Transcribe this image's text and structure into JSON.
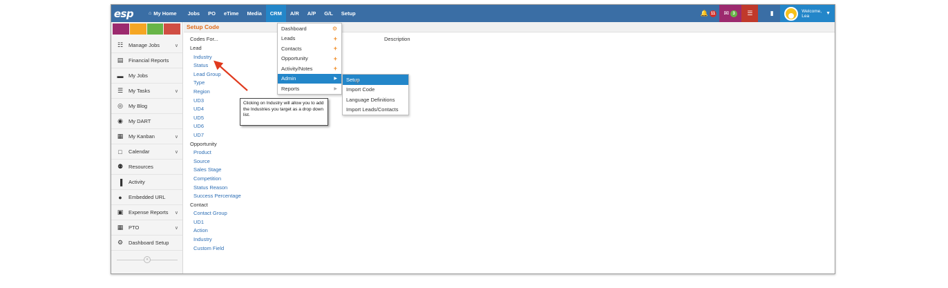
{
  "nav": {
    "logo": "esp",
    "items": [
      {
        "label": "My Home",
        "icon": "home-icon"
      },
      {
        "label": "Jobs"
      },
      {
        "label": "PO"
      },
      {
        "label": "eTime"
      },
      {
        "label": "Media"
      },
      {
        "label": "CRM",
        "active": true
      },
      {
        "label": "A/R"
      },
      {
        "label": "A/P"
      },
      {
        "label": "G/L"
      },
      {
        "label": "Setup"
      }
    ],
    "notifications_count": "11",
    "messages_count": "3",
    "welcome": "Welcome,",
    "user": "Lea"
  },
  "sidebar": {
    "swatches": [
      "#9c2a6e",
      "#f5a623",
      "#68b548",
      "#d04e43"
    ],
    "items": [
      {
        "label": "Manage Jobs",
        "icon": "sitemap-icon",
        "chevron": true
      },
      {
        "label": "Financial Reports",
        "icon": "report-icon",
        "chevron": false
      },
      {
        "label": "My Jobs",
        "icon": "folder-icon",
        "chevron": false
      },
      {
        "label": "My Tasks",
        "icon": "tasks-icon",
        "chevron": true
      },
      {
        "label": "My Blog",
        "icon": "chat-icon",
        "chevron": false
      },
      {
        "label": "My DART",
        "icon": "dart-icon",
        "chevron": false
      },
      {
        "label": "My Kanban",
        "icon": "kanban-icon",
        "chevron": true
      },
      {
        "label": "Calendar",
        "icon": "calendar-icon",
        "chevron": true
      },
      {
        "label": "Resources",
        "icon": "users-icon",
        "chevron": false
      },
      {
        "label": "Activity",
        "icon": "bar-chart-icon",
        "chevron": false
      },
      {
        "label": "Embedded URL",
        "icon": "globe-icon",
        "chevron": false
      },
      {
        "label": "Expense Reports",
        "icon": "money-icon",
        "chevron": true
      },
      {
        "label": "PTO",
        "icon": "calendar-grid-icon",
        "chevron": true
      },
      {
        "label": "Dashboard Setup",
        "icon": "gears-icon",
        "chevron": false
      }
    ]
  },
  "content": {
    "title": "Setup Code",
    "codes_header": "Codes For...",
    "description_header": "Description",
    "groups": [
      {
        "name": "Lead",
        "links": [
          "Industry",
          "Status",
          "Lead Group",
          "Type",
          "Region",
          "UD3",
          "UD4",
          "UD5",
          "UD6",
          "UD7"
        ]
      },
      {
        "name": "Opportunity",
        "links": [
          "Product",
          "Source",
          "Sales Stage",
          "Competition",
          "Status Reason",
          "Success Percentage"
        ]
      },
      {
        "name": "Contact",
        "links": [
          "Contact Group",
          "UD1",
          "Action",
          "Industry",
          "Custom Field"
        ]
      }
    ]
  },
  "crm_menu": {
    "items": [
      {
        "label": "Dashboard",
        "suffix": "gear"
      },
      {
        "label": "Leads",
        "suffix": "plus"
      },
      {
        "label": "Contacts",
        "suffix": "plus"
      },
      {
        "label": "Opportunity",
        "suffix": "plus"
      },
      {
        "label": "Activity/Notes",
        "suffix": "plus"
      },
      {
        "label": "Admin",
        "suffix": "arrow",
        "highlighted": true
      },
      {
        "label": "Reports",
        "suffix": "arrow"
      }
    ]
  },
  "admin_submenu": {
    "items": [
      {
        "label": "Setup",
        "highlighted": true
      },
      {
        "label": "Import Code"
      },
      {
        "label": "Language Definitions"
      },
      {
        "label": "Import Leads/Contacts"
      }
    ]
  },
  "callout": {
    "text": "Clicking on Industry will allow you to add the Industries you target as a drop down list."
  },
  "colors": {
    "nav_bg": "#3a6ea5",
    "nav_active": "#2386c9",
    "title_orange": "#e06b1a",
    "link_blue": "#2e6fb5",
    "plus_orange": "#f0891f"
  }
}
